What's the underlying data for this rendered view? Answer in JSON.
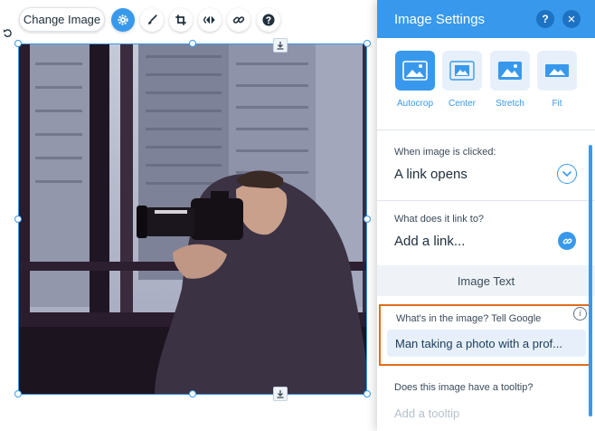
{
  "toolbar": {
    "change_image_label": "Change Image",
    "tools": [
      "gear-icon",
      "brush-icon",
      "crop-icon",
      "animation-icon",
      "link-icon",
      "help-icon"
    ]
  },
  "panel": {
    "title": "Image Settings",
    "help_label": "?",
    "close_label": "×",
    "fill_options": [
      {
        "label": "Autocrop",
        "selected": true
      },
      {
        "label": "Center",
        "selected": false
      },
      {
        "label": "Stretch",
        "selected": false
      },
      {
        "label": "Fit",
        "selected": false
      }
    ],
    "click_action": {
      "label": "When image is clicked:",
      "value": "A link opens"
    },
    "link_to": {
      "label": "What does it link to?",
      "value": "Add a link..."
    },
    "image_text_section": "Image Text",
    "alt_text": {
      "label": "What's in the image? Tell Google",
      "value": "Man taking a photo with a prof..."
    },
    "tooltip": {
      "label": "Does this image have a tooltip?",
      "placeholder": "Add a tooltip"
    }
  },
  "colors": {
    "accent": "#3899ec",
    "highlight": "#e06c1e"
  }
}
